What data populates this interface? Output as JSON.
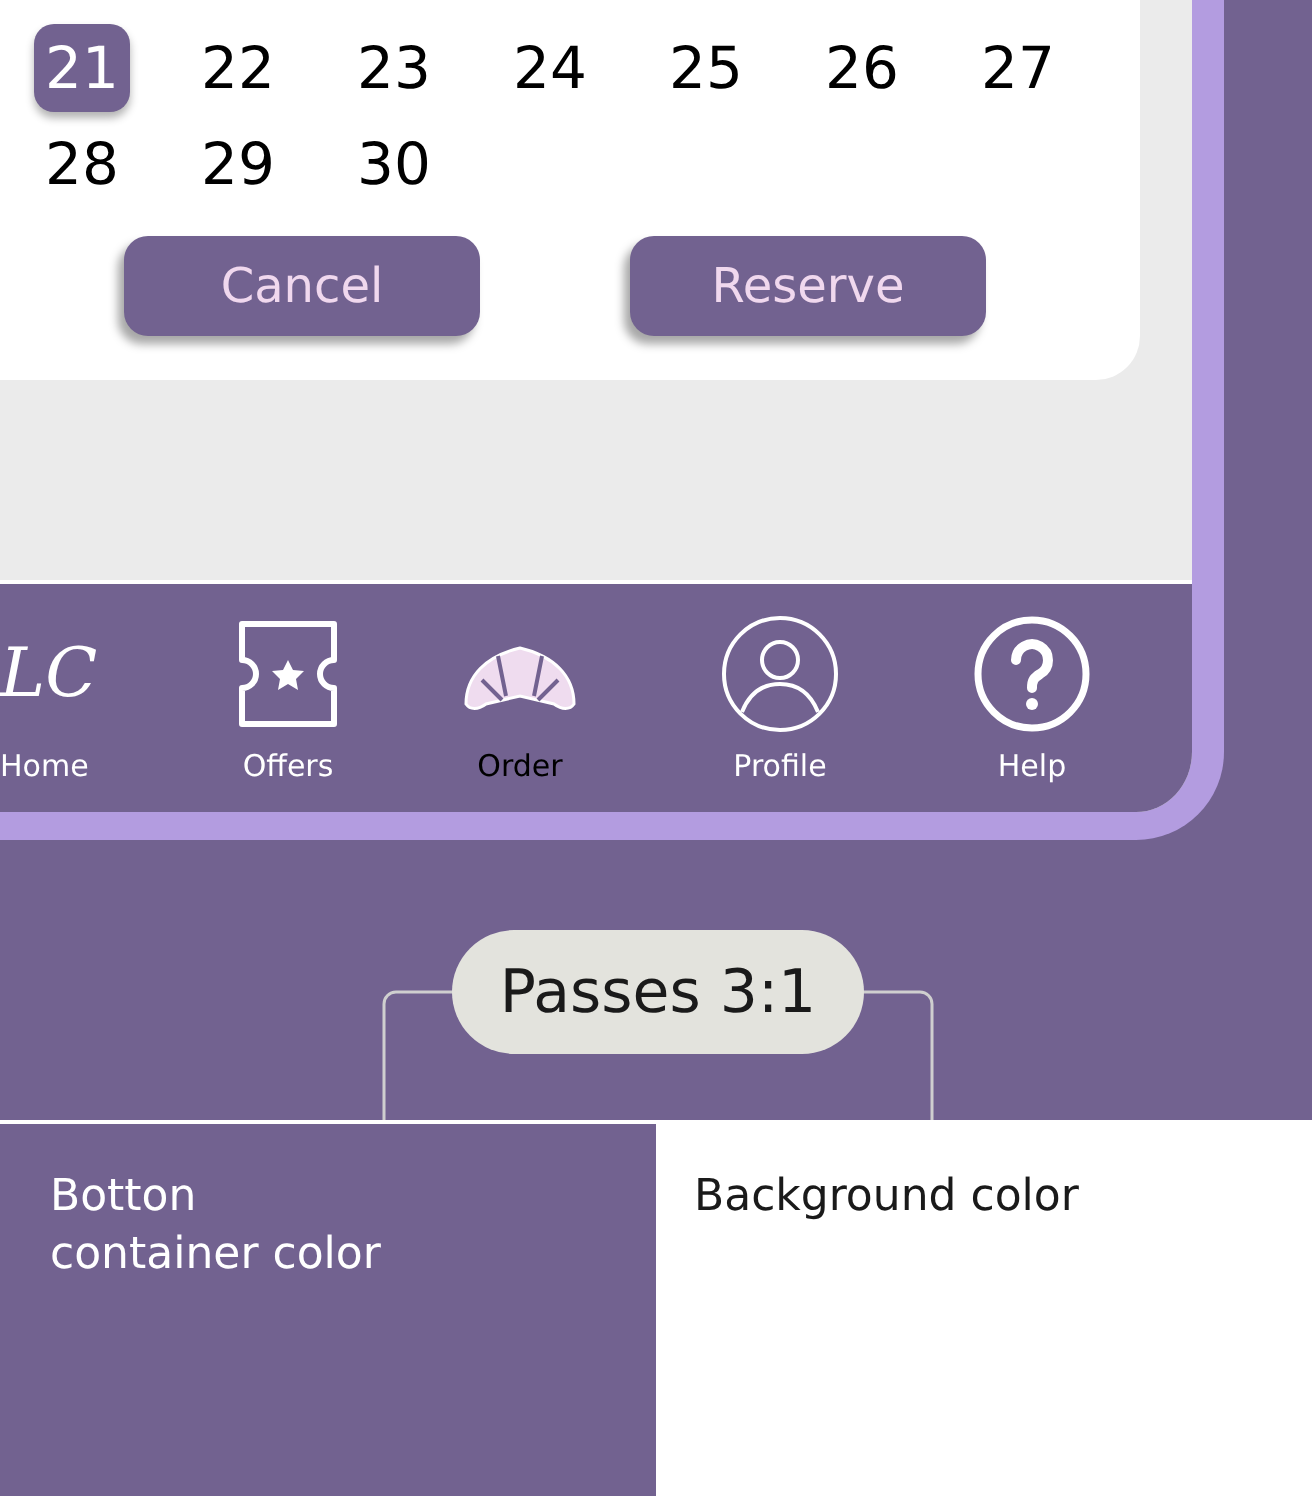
{
  "calendar": {
    "days": [
      {
        "label": "21",
        "selected": true
      },
      {
        "label": "22",
        "selected": false
      },
      {
        "label": "23",
        "selected": false
      },
      {
        "label": "24",
        "selected": false
      },
      {
        "label": "25",
        "selected": false
      },
      {
        "label": "26",
        "selected": false
      },
      {
        "label": "27",
        "selected": false
      },
      {
        "label": "28",
        "selected": false
      },
      {
        "label": "29",
        "selected": false
      },
      {
        "label": "30",
        "selected": false
      }
    ]
  },
  "buttons": [
    "Cancel",
    "Reserve"
  ],
  "nav": [
    {
      "kind": "logo",
      "logo_text": "LC",
      "label": "Home",
      "selected": false
    },
    {
      "kind": "ticket",
      "label": "Offers",
      "selected": false
    },
    {
      "kind": "croissant",
      "label": "Order",
      "selected": true
    },
    {
      "kind": "profile",
      "label": "Profile",
      "selected": false
    },
    {
      "kind": "help",
      "label": "Help",
      "selected": false
    }
  ],
  "contrast_badge": "Passes 3:1",
  "swatches": [
    {
      "label": "Botton\ncontainer color",
      "color": "#726290"
    },
    {
      "label": "Background color",
      "color": "#ffffff"
    }
  ]
}
